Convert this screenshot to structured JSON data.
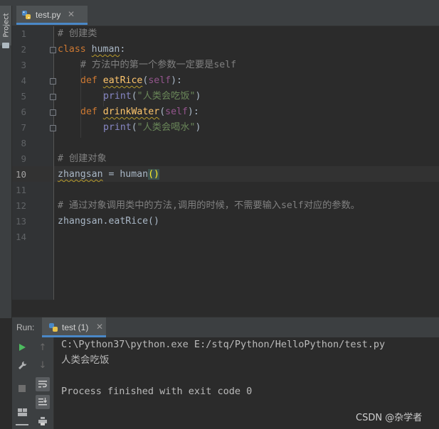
{
  "window": {
    "partial_title": "· · · · · ·"
  },
  "left_strip": {
    "project_label": "Project"
  },
  "tabs": [
    {
      "label": "test.py",
      "close": "✕"
    }
  ],
  "editor": {
    "line_numbers": [
      "1",
      "2",
      "3",
      "4",
      "5",
      "6",
      "7",
      "8",
      "9",
      "10",
      "11",
      "12",
      "13",
      "14"
    ],
    "active_line": "10",
    "lines": {
      "l1": "# 创建类",
      "l2_kw": "class",
      "l2_name": "human",
      "l2_colon": ":",
      "l3": "# 方法中的第一个参数一定要是self",
      "l4_kw": "def",
      "l4_fn": "eatRice",
      "l4_open": "(",
      "l4_self": "self",
      "l4_close": "):",
      "l5_print": "print",
      "l5_open": "(",
      "l5_str": "\"人类会吃饭\"",
      "l5_close": ")",
      "l6_kw": "def",
      "l6_fn": "drinkWater",
      "l6_open": "(",
      "l6_self": "self",
      "l6_close": "):",
      "l7_print": "print",
      "l7_open": "(",
      "l7_str": "\"人类会喝水\"",
      "l7_close": ")",
      "l9": "# 创建对象",
      "l10_var": "zhangsan",
      "l10_eq": " = human",
      "l10_paren": "()",
      "l12": "# 通过对象调用类中的方法,调用的时候，不需要输入self对应的参数。",
      "l13": "zhangsan.eatRice()"
    }
  },
  "run_panel": {
    "label": "Run:",
    "tab_label": "test (1)",
    "tab_close": "✕",
    "console": {
      "cmd": "C:\\Python37\\python.exe E:/stq/Python/HelloPython/test.py",
      "output": "人类会吃饭",
      "exit": "Process finished with exit code 0"
    }
  },
  "watermark": "CSDN @杂学者",
  "colors": {
    "background": "#2b2b2b",
    "keyword": "#cc7832",
    "comment": "#808080",
    "function": "#ffc66d",
    "string": "#6a8759",
    "self": "#94558d",
    "builtin": "#8888c6",
    "accent": "#4a88c7"
  }
}
